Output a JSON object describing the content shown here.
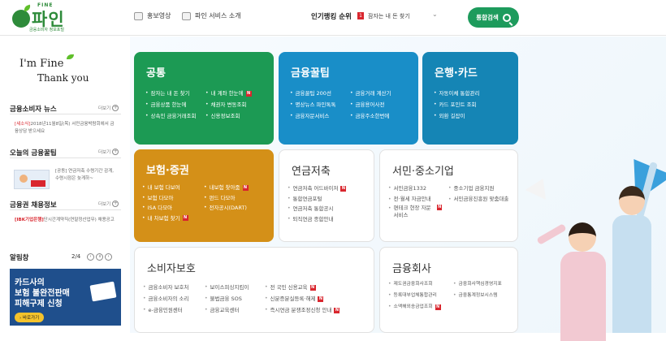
{
  "header": {
    "logo_top": "FINE",
    "logo_name": "파인",
    "logo_sub": "금융소비자 정보포털",
    "link_video": "홍보영상",
    "link_intro": "파인 서비스 소개",
    "rank_title": "인기랭킹 순위",
    "rank_num": "1",
    "rank_item": "잠자는 내 돈 찾기",
    "search_label": "통합검색"
  },
  "sidebar": {
    "greeting_1": "I'm Fine",
    "greeting_2": "Thank you",
    "more": "더보기",
    "news_title": "금융소비자 뉴스",
    "news_tag": "[세소식]",
    "news_text": "2018년11월8일(목) 서민금융박람회에서 금융상담 받으세요",
    "tip_title": "오늘의 금융꿀팁",
    "tip_text": "[공동] 연금저축 수령기간 감게, 수령시점은 늦게하~",
    "job_title": "금융권 채용정보",
    "job_tag": "[IBK기업은행]",
    "job_text": "단시간계약직(연말정산업무) 채용공고",
    "alim_title": "알림창",
    "alim_page": "2/4",
    "banner_line1": "카드사의",
    "banner_line2": "보험 불완전판매",
    "banner_line3": "피해구제 신청",
    "banner_btn": "› 바로가기"
  },
  "tiles": {
    "common": {
      "title": "공통",
      "col1": [
        "잠자는 내 돈 찾기",
        "금융상품 한눈에",
        "상속인 금융거래조회"
      ],
      "col2": [
        "내 계좌 한눈에",
        "채권자 변동조회",
        "신용정보조회"
      ]
    },
    "tips": {
      "title": "금융꿀팁",
      "col1": [
        "금융꿀팁 200선",
        "명상뉴스 파인톡톡",
        "금융자문서비스"
      ],
      "col2": [
        "금융거래 계산기",
        "금융용어사전",
        "금융주소한번에"
      ]
    },
    "bank": {
      "title": "은행·카드",
      "col1": [
        "자동이체 통합관리",
        "카드 포인트 조회",
        "외환 길잡이"
      ]
    },
    "insurance": {
      "title": "보험·증권",
      "col1": [
        "내 보험 다보여",
        "보험 다모아",
        "ISA 다모아",
        "내 차보험 찾기"
      ],
      "col2": [
        "내보험 찾아줌",
        "펀드 다모아",
        "전자공시(DART)"
      ]
    },
    "pension": {
      "title": "연금저축",
      "col1": [
        "연금저축 어드바이저",
        "통합연금포털",
        "연금저축 통합공시",
        "퇴직연금 종합안내"
      ]
    },
    "seomin": {
      "title": "서민·중소기업",
      "col1": [
        "서민금융1332",
        "전·월세 자금안내",
        "편테크 현장 자문서비스"
      ],
      "col2": [
        "중소기업 금융지원",
        "서민금융진흥원 맞춤대출"
      ]
    },
    "consumer": {
      "title": "소비자보호",
      "col1": [
        "금융소비자 보호처",
        "금융소비자의 소리",
        "e-금융민원센터"
      ],
      "col2": [
        "보이스피싱지킴이",
        "불법금융 SOS",
        "금융교육센터"
      ],
      "col3": [
        "전 국민 신용교육",
        "신분증분실등록·해제",
        "즉시연금 분쟁조정신청 안내"
      ]
    },
    "company": {
      "title": "금융회사",
      "col1": [
        "제도권금융회사조회",
        "등록대부업체통합관리",
        "소액해외송금업조회"
      ],
      "col2": [
        "금융회사핵심경영지표",
        "금융통계정보시스템"
      ]
    }
  },
  "colors": {
    "green": "#1c9a54",
    "blue": "#198ec8",
    "teal": "#1585b5",
    "orange": "#d49018",
    "new_badge": "#d9262e"
  },
  "new_badge": "N"
}
